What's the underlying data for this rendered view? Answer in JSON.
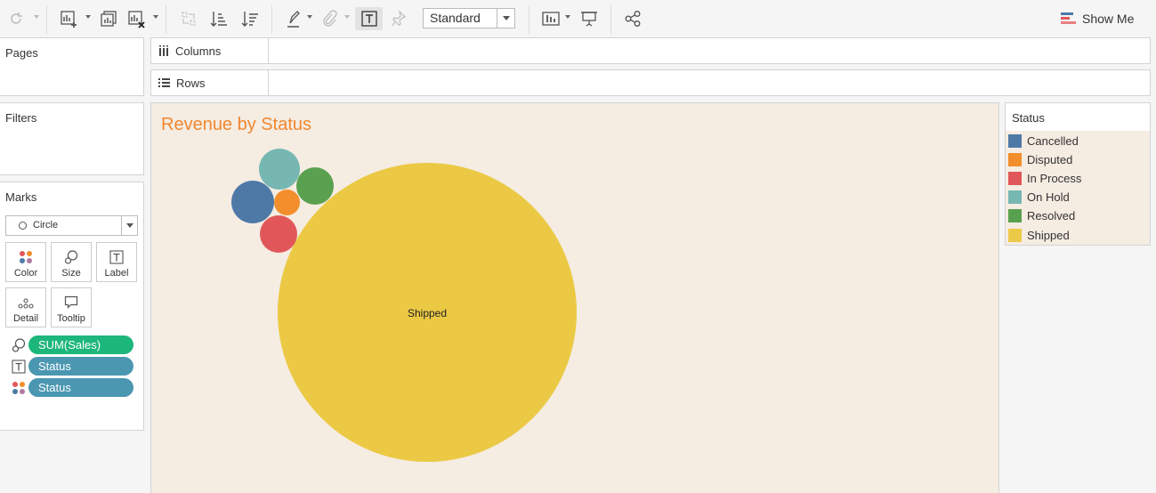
{
  "toolbar": {
    "view_mode": "Standard",
    "show_me": "Show Me"
  },
  "panels": {
    "pages_title": "Pages",
    "filters_title": "Filters",
    "marks_title": "Marks"
  },
  "marks": {
    "mark_type": "Circle",
    "buttons": [
      {
        "label": "Color",
        "icon": "color-dots-icon"
      },
      {
        "label": "Size",
        "icon": "size-icon"
      },
      {
        "label": "Label",
        "icon": "text-label-icon"
      },
      {
        "label": "Detail",
        "icon": "detail-dots-icon"
      },
      {
        "label": "Tooltip",
        "icon": "tooltip-icon"
      }
    ],
    "pills": [
      {
        "text": "SUM(Sales)",
        "icon": "size-icon"
      },
      {
        "text": "Status",
        "icon": "text-label-icon"
      },
      {
        "text": "Status",
        "icon": "color-dots-icon"
      }
    ]
  },
  "shelves": {
    "columns_label": "Columns",
    "rows_label": "Rows"
  },
  "viz": {
    "title": "Revenue by Status",
    "shipped_label": "Shipped"
  },
  "legend": {
    "title": "Status",
    "items": [
      {
        "label": "Cancelled",
        "color": "#4e79a7"
      },
      {
        "label": "Disputed",
        "color": "#f28e2b"
      },
      {
        "label": "In Process",
        "color": "#e15759"
      },
      {
        "label": "On Hold",
        "color": "#76b7b2"
      },
      {
        "label": "Resolved",
        "color": "#59a14f"
      },
      {
        "label": "Shipped",
        "color": "#edc948"
      }
    ]
  },
  "colors": {
    "title_accent": "#f0872f",
    "pill_measure": "#1db67b",
    "pill_dimension": "#4b97b2",
    "canvas_bg": "#f5ece2"
  }
}
